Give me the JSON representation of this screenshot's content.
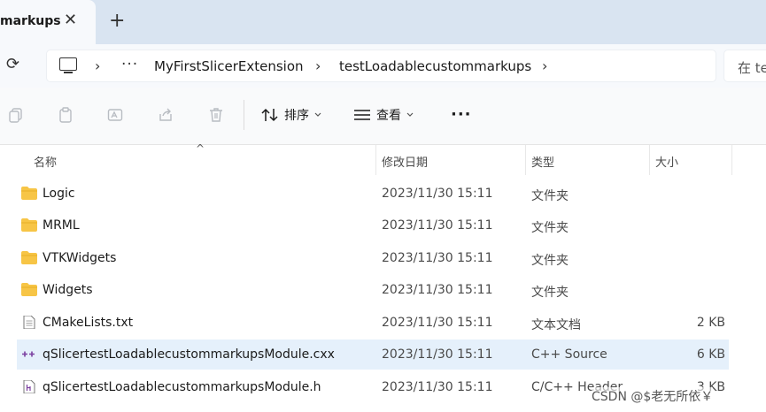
{
  "tabs": {
    "active_title": "markups",
    "close_glyph": "✕",
    "new_tab_glyph": "+"
  },
  "nav": {
    "refresh_glyph": "⟳",
    "overflow_glyph": "···",
    "breadcrumbs": [
      "MyFirstSlicerExtension",
      "testLoadablecustommarkups"
    ],
    "separator": "›",
    "search_placeholder": "在 te"
  },
  "toolbar": {
    "sort_label": "排序",
    "view_label": "查看",
    "more_glyph": "···",
    "icons": [
      "copy-icon",
      "paste-icon",
      "rename-icon",
      "share-icon",
      "delete-icon"
    ]
  },
  "columns": {
    "name": "名称",
    "modified": "修改日期",
    "type": "类型",
    "size": "大小",
    "sort_glyph": "^"
  },
  "files": [
    {
      "name": "Logic",
      "date": "2023/11/30 15:11",
      "type": "文件夹",
      "size": "",
      "icon": "folder-icon"
    },
    {
      "name": "MRML",
      "date": "2023/11/30 15:11",
      "type": "文件夹",
      "size": "",
      "icon": "folder-icon"
    },
    {
      "name": "VTKWidgets",
      "date": "2023/11/30 15:11",
      "type": "文件夹",
      "size": "",
      "icon": "folder-icon"
    },
    {
      "name": "Widgets",
      "date": "2023/11/30 15:11",
      "type": "文件夹",
      "size": "",
      "icon": "folder-icon"
    },
    {
      "name": "CMakeLists.txt",
      "date": "2023/11/30 15:11",
      "type": "文本文档",
      "size": "2 KB",
      "icon": "text-file-icon"
    },
    {
      "name": "qSlicertestLoadablecustommarkupsModule.cxx",
      "date": "2023/11/30 15:11",
      "type": "C++ Source",
      "size": "6 KB",
      "icon": "cpp-source-icon",
      "selected": true
    },
    {
      "name": "qSlicertestLoadablecustommarkupsModule.h",
      "date": "2023/11/30 15:11",
      "type": "C/C++ Header",
      "size": "3 KB",
      "icon": "header-file-icon"
    }
  ],
  "watermark": "CSDN @$老无所依￥",
  "colors": {
    "folder": "#f7c546",
    "selected_row": "#e5f0fb",
    "tabstrip": "#d9e4f1"
  }
}
